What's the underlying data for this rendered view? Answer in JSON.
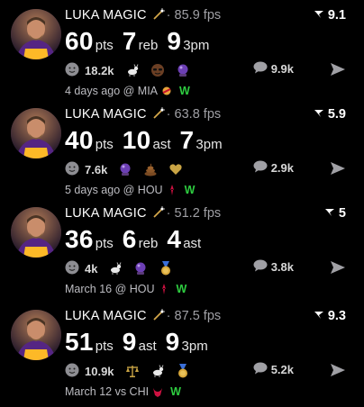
{
  "posts": [
    {
      "name": "LUKA MAGIC",
      "fps": "85.9 fps",
      "score": "9.1",
      "stats": [
        {
          "num": "60",
          "lbl": "pts"
        },
        {
          "num": "7",
          "lbl": "reb"
        },
        {
          "num": "9",
          "lbl": "3pm"
        }
      ],
      "reactions_count": "18.2k",
      "emojis": [
        "goat-icon",
        "sunglasses-emoji-icon",
        "crystal-ball-icon"
      ],
      "comments": "9.9k",
      "when": "4 days ago @ MIA",
      "team_icon": "heat-logo-icon",
      "result": "W"
    },
    {
      "name": "LUKA MAGIC",
      "fps": "63.8 fps",
      "score": "5.9",
      "stats": [
        {
          "num": "40",
          "lbl": "pts"
        },
        {
          "num": "10",
          "lbl": "ast"
        },
        {
          "num": "7",
          "lbl": "3pm"
        }
      ],
      "reactions_count": "7.6k",
      "emojis": [
        "crystal-ball-icon",
        "poop-emoji-icon",
        "gold-heart-icon"
      ],
      "comments": "2.9k",
      "when": "5 days ago @ HOU",
      "team_icon": "rockets-logo-icon",
      "result": "W"
    },
    {
      "name": "LUKA MAGIC",
      "fps": "51.2 fps",
      "score": "5",
      "stats": [
        {
          "num": "36",
          "lbl": "pts"
        },
        {
          "num": "6",
          "lbl": "reb"
        },
        {
          "num": "4",
          "lbl": "ast"
        }
      ],
      "reactions_count": "4k",
      "emojis": [
        "goat-icon",
        "crystal-ball-icon",
        "medal-icon"
      ],
      "comments": "3.8k",
      "when": "March 16 @ HOU",
      "team_icon": "rockets-logo-icon",
      "result": "W"
    },
    {
      "name": "LUKA MAGIC",
      "fps": "87.5 fps",
      "score": "9.3",
      "stats": [
        {
          "num": "51",
          "lbl": "pts"
        },
        {
          "num": "9",
          "lbl": "ast"
        },
        {
          "num": "9",
          "lbl": "3pm"
        }
      ],
      "reactions_count": "10.9k",
      "emojis": [
        "scales-icon",
        "goat-icon",
        "medal-icon"
      ],
      "comments": "5.2k",
      "when": "March 12 vs CHI",
      "team_icon": "bulls-logo-icon",
      "result": "W"
    }
  ]
}
